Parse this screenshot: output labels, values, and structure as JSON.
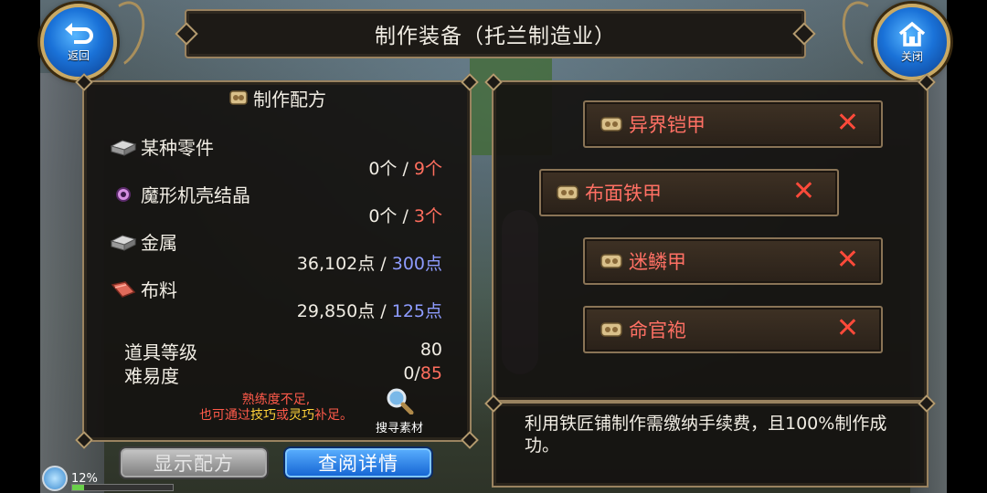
{
  "header": {
    "title": "制作装备（托兰制造业）",
    "back_label": "返回",
    "close_label": "关闭"
  },
  "recipe": {
    "heading": "制作配方",
    "materials": [
      {
        "name": "某种零件",
        "icon": "metal-part-icon",
        "have": "0个",
        "sep": " / ",
        "need": "9个",
        "need_color": "#ff6e5e"
      },
      {
        "name": "魔形机壳结晶",
        "icon": "crystal-icon",
        "have": "0个",
        "sep": " / ",
        "need": "3个",
        "need_color": "#ff6e5e"
      },
      {
        "name": "金属",
        "icon": "metal-icon",
        "have": "36,102点",
        "sep": " / ",
        "need": "300点",
        "need_color": "#8e9cff"
      },
      {
        "name": "布料",
        "icon": "cloth-icon",
        "have": "29,850点",
        "sep": " / ",
        "need": "125点",
        "need_color": "#8e9cff"
      }
    ],
    "item_level_label": "道具等级",
    "item_level_value": "80",
    "difficulty_label": "难易度",
    "difficulty_have": "0/",
    "difficulty_need": "85",
    "warning_line1": "熟练度不足,",
    "warning_line2_a": "也可通过",
    "warning_line2_b": "技巧",
    "warning_line2_c": "或",
    "warning_line2_d": "灵巧",
    "warning_line2_e": "补足。",
    "search_label": "搜寻素材"
  },
  "buttons": {
    "show_recipe": "显示配方",
    "view_details": "查阅详情"
  },
  "equipment": [
    {
      "name": "异界铠甲",
      "remove": "✕"
    },
    {
      "name": "布面铁甲",
      "remove": "✕"
    },
    {
      "name": "迷鳞甲",
      "remove": "✕"
    },
    {
      "name": "命官袍",
      "remove": "✕"
    }
  ],
  "description": "利用铁匠铺制作需缴纳手续费，且100%制作成功。",
  "status": {
    "percent_text": "12%",
    "percent": 12
  },
  "colors": {
    "accent_red": "#ff6e5e",
    "accent_blue": "#8e9cff",
    "frame_gold": "#9a8360",
    "button_blue": "#1262d2"
  }
}
